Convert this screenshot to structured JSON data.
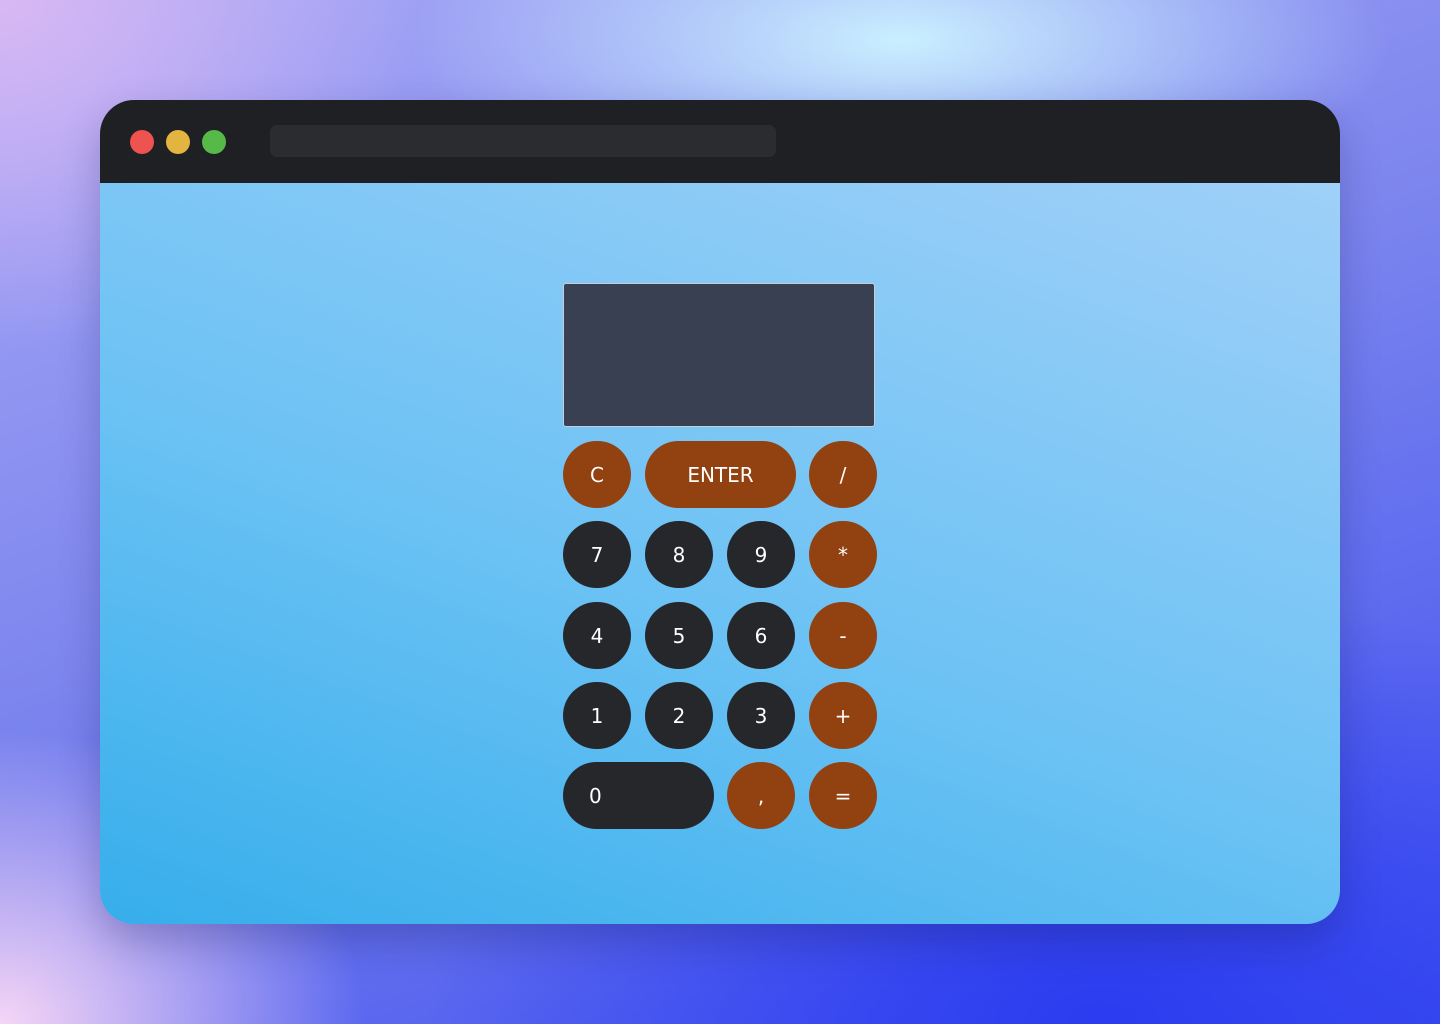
{
  "window": {
    "controls": [
      "close",
      "minimize",
      "maximize"
    ],
    "address_bar": ""
  },
  "calculator": {
    "display_value": "",
    "keys": {
      "clear": "C",
      "enter": "ENTER",
      "divide": "/",
      "seven": "7",
      "eight": "8",
      "nine": "9",
      "multiply": "*",
      "four": "4",
      "five": "5",
      "six": "6",
      "subtract": "-",
      "one": "1",
      "two": "2",
      "three": "3",
      "add": "+",
      "zero": "0",
      "comma": ",",
      "equals": "="
    }
  },
  "colors": {
    "operator_key": "#924111",
    "digit_key": "#26272b",
    "display": "#384052",
    "titlebar": "#1f2023"
  }
}
